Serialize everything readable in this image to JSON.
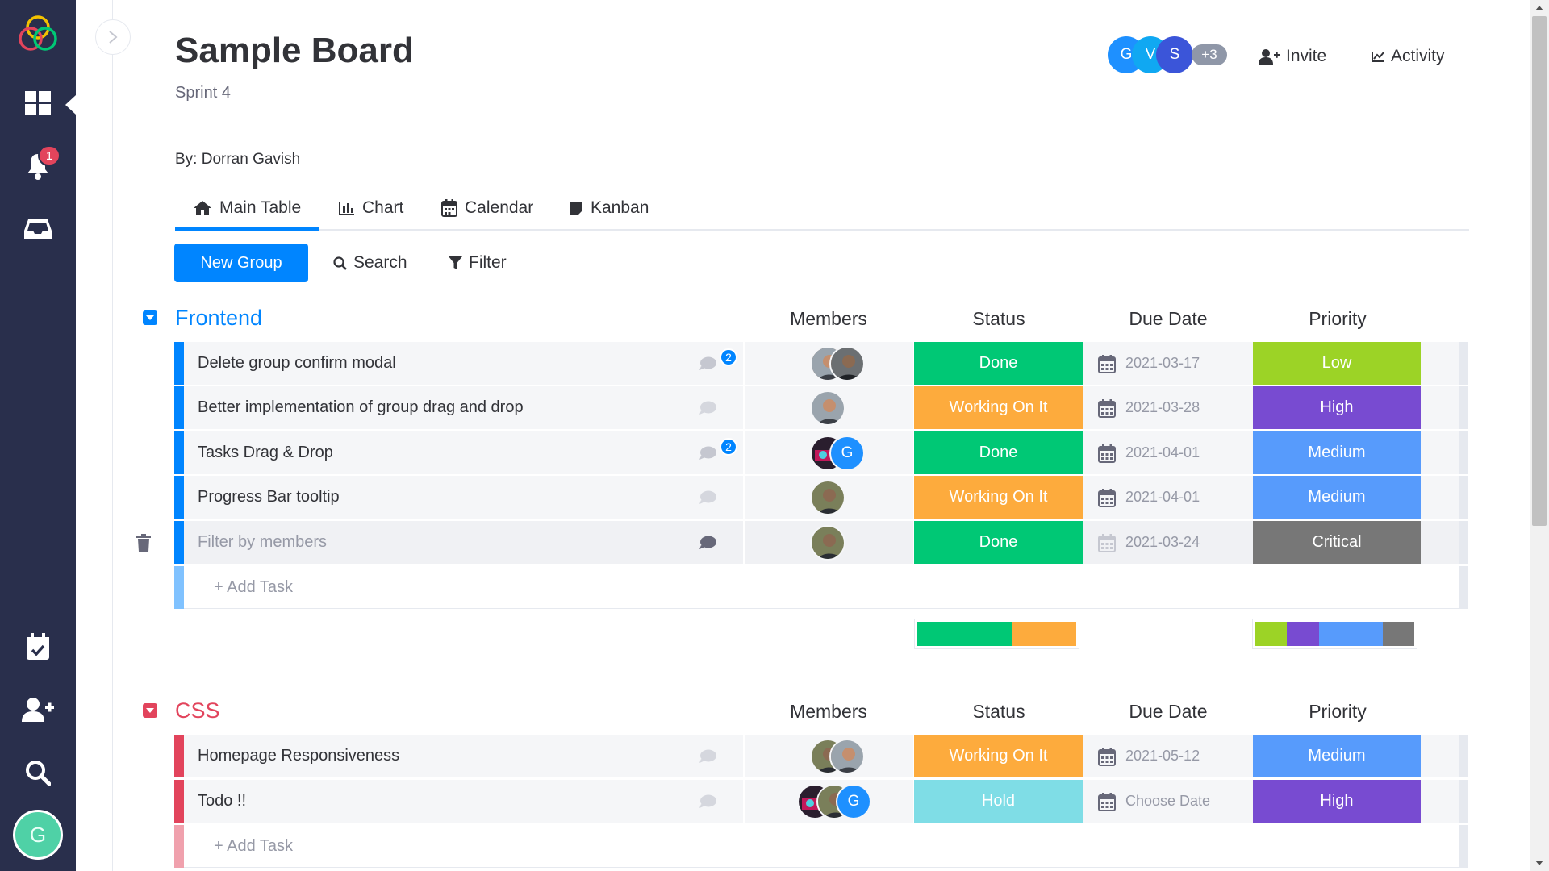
{
  "rail": {
    "notification_count": "1",
    "user_initial": "G",
    "icons": [
      "logo-icon",
      "boards-icon",
      "bell-icon",
      "inbox-icon",
      "calendar-check-icon",
      "invite-user-icon",
      "search-icon"
    ]
  },
  "board": {
    "title": "Sample Board",
    "subtitle": "Sprint 4",
    "author": "By: Dorran Gavish"
  },
  "header": {
    "members": [
      "G",
      "V",
      "S"
    ],
    "more_members": "+3",
    "invite_label": "Invite",
    "activity_label": "Activity"
  },
  "tabs": [
    {
      "label": "Main Table",
      "icon": "home-icon"
    },
    {
      "label": "Chart",
      "icon": "bar-chart-icon"
    },
    {
      "label": "Calendar",
      "icon": "calendar-icon"
    },
    {
      "label": "Kanban",
      "icon": "sticky-note-icon"
    }
  ],
  "toolbar": {
    "new_group_label": "New Group",
    "search_label": "Search",
    "filter_label": "Filter"
  },
  "columns": {
    "members": "Members",
    "status": "Status",
    "due_date": "Due Date",
    "priority": "Priority"
  },
  "colors": {
    "done": "#00c875",
    "working": "#fdab3d",
    "hold": "#7fdde6",
    "low": "#9cd326",
    "high": "#784bd1",
    "medium": "#579bfc",
    "critical": "#777777",
    "frontend": "#0085ff",
    "css": "#e2445c"
  },
  "groups": [
    {
      "title": "Frontend",
      "add_task_label": "+ Add Task",
      "tasks": [
        {
          "name": "Delete group confirm modal",
          "comments": "2",
          "status": "Done",
          "due": "2021-03-17",
          "priority": "Low"
        },
        {
          "name": "Better implementation of group drag and drop",
          "comments": "",
          "status": "Working On It",
          "due": "2021-03-28",
          "priority": "High"
        },
        {
          "name": "Tasks Drag & Drop",
          "comments": "2",
          "status": "Done",
          "due": "2021-04-01",
          "priority": "Medium"
        },
        {
          "name": "Progress Bar tooltip",
          "comments": "",
          "status": "Working On It",
          "due": "2021-04-01",
          "priority": "Medium"
        },
        {
          "name": "Filter by members",
          "comments": "",
          "status": "Done",
          "due": "2021-03-24",
          "priority": "Critical"
        }
      ],
      "status_summary": [
        {
          "status": "Done",
          "share": 0.6
        },
        {
          "status": "Working On It",
          "share": 0.4
        }
      ],
      "priority_summary": [
        {
          "priority": "Low",
          "share": 0.2
        },
        {
          "priority": "High",
          "share": 0.2
        },
        {
          "priority": "Medium",
          "share": 0.4
        },
        {
          "priority": "Critical",
          "share": 0.2
        }
      ]
    },
    {
      "title": "CSS",
      "add_task_label": "+ Add Task",
      "tasks": [
        {
          "name": "Homepage Responsiveness",
          "comments": "",
          "status": "Working On It",
          "due": "2021-05-12",
          "priority": "Medium"
        },
        {
          "name": "Todo !!",
          "comments": "",
          "status": "Hold",
          "due": "Choose Date",
          "priority": "High"
        }
      ]
    }
  ]
}
